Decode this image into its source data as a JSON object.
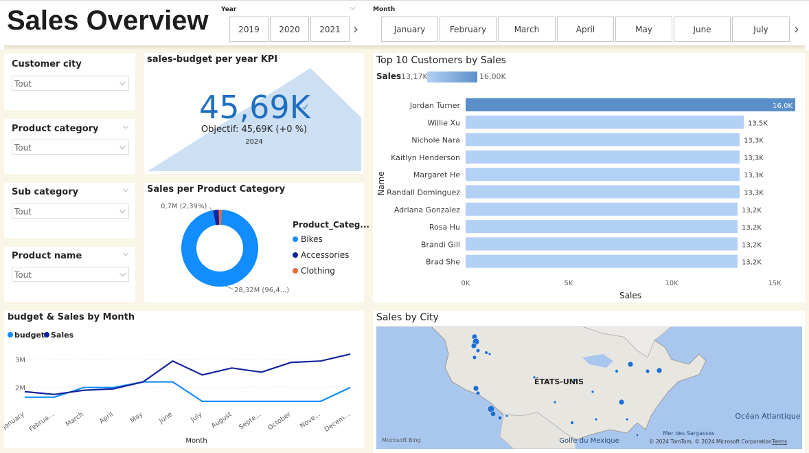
{
  "header": {
    "title": "Sales Overview",
    "year_caption": "Year",
    "month_caption": "Month",
    "years": [
      "2019",
      "2020",
      "2021"
    ],
    "months": [
      "January",
      "February",
      "March",
      "May",
      "June",
      "July"
    ],
    "months_visible": [
      "January",
      "February",
      "March",
      "April",
      "May",
      "June",
      "July"
    ]
  },
  "filters": {
    "customer_city": {
      "label": "Customer city",
      "value": "Tout"
    },
    "product_category": {
      "label": "Product category",
      "value": "Tout"
    },
    "sub_category": {
      "label": "Sub category",
      "value": "Tout"
    },
    "product_name": {
      "label": "Product name",
      "value": "Tout"
    }
  },
  "kpi": {
    "title": "sales-budget per year KPI",
    "value": "45,69K",
    "goal": "Objectif: 45,69K (+0 %)",
    "year": "2024"
  },
  "donut": {
    "title": "Sales per Product Category",
    "legend_title": "Product_Categ...",
    "label_small": "0,7M (2,39%)",
    "label_large": "28,32M (96,4...)",
    "slices": [
      {
        "name": "Bikes",
        "value": 96.4,
        "color": "#118dff"
      },
      {
        "name": "Accessories",
        "value": 2.39,
        "color": "#12239e"
      },
      {
        "name": "Clothing",
        "value": 1.21,
        "color": "#e66c37"
      }
    ]
  },
  "top_customers": {
    "title": "Top 10 Customers by Sales",
    "legend_label": "Sales",
    "legend_min": "13,17K",
    "legend_max": "16,00K",
    "ylabel": "Name",
    "xlabel": "Sales",
    "ticks": [
      "0K",
      "5K",
      "10K",
      "15K"
    ],
    "max_color": "#5b8fc9",
    "bar_color": "#b3d0f5"
  },
  "chart_data": [
    {
      "type": "bar",
      "title": "Top 10 Customers by Sales",
      "orientation": "horizontal",
      "categories": [
        "Jordan Turner",
        "Willie Xu",
        "Nichole Nara",
        "Kaitlyn Henderson",
        "Margaret He",
        "Randall Dominguez",
        "Adriana Gonzalez",
        "Rosa Hu",
        "Brandi Gill",
        "Brad She"
      ],
      "values": [
        16.0,
        13.5,
        13.3,
        13.3,
        13.3,
        13.3,
        13.2,
        13.2,
        13.2,
        13.2
      ],
      "value_labels": [
        "16,0K",
        "13,5K",
        "13,3K",
        "13,3K",
        "13,3K",
        "13,3K",
        "13,2K",
        "13,2K",
        "13,2K",
        "13,2K"
      ],
      "xlabel": "Sales",
      "ylabel": "Name",
      "xlim": [
        0,
        15
      ]
    },
    {
      "type": "line",
      "title": "budget & Sales by Month",
      "categories": [
        "January",
        "Februa...",
        "March",
        "April",
        "May",
        "June",
        "July",
        "August",
        "Septe...",
        "October",
        "Nove...",
        "Decem..."
      ],
      "series": [
        {
          "name": "budget",
          "color": "#118dff",
          "values": [
            1.65,
            1.65,
            2.0,
            2.0,
            2.2,
            2.2,
            1.5,
            1.5,
            1.5,
            1.5,
            1.5,
            2.0
          ]
        },
        {
          "name": "Sales",
          "color": "#12239e",
          "values": [
            1.85,
            1.75,
            1.9,
            1.95,
            2.2,
            2.95,
            2.45,
            2.7,
            2.55,
            2.9,
            2.95,
            3.2
          ]
        }
      ],
      "yticks": [
        "2M",
        "3M"
      ],
      "xlabel": "Month",
      "ylim": [
        1.3,
        3.4
      ]
    },
    {
      "type": "pie",
      "title": "Sales per Product Category",
      "categories": [
        "Bikes",
        "Accessories",
        "Clothing"
      ],
      "values": [
        96.4,
        2.39,
        1.21
      ]
    }
  ],
  "line_chart": {
    "title": "budget & Sales by Month",
    "legend": [
      {
        "name": "budget",
        "color": "#118dff"
      },
      {
        "name": "Sales",
        "color": "#12239e"
      }
    ],
    "xlabel": "Month"
  },
  "map": {
    "title": "Sales by City",
    "country_label": "ÉTATS-UNIS",
    "ocean_label": "Océan Atlantique",
    "sea_label": "Mer des Sargasses",
    "gulf_label": "Golfe du Mexique",
    "attribution": "© 2024 TomTom, © 2024 Microsoft Corporation",
    "terms": "Terms",
    "provider": "Microsoft Bing"
  }
}
